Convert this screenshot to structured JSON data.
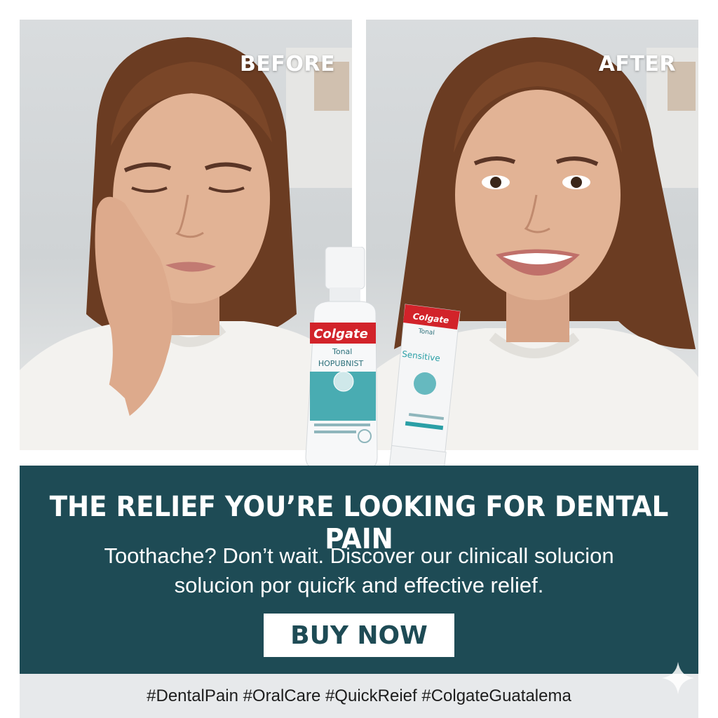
{
  "photos": {
    "before_label": "BEFORE",
    "after_label": "AFTER"
  },
  "products": {
    "mouthwash_brand": "Colgate",
    "mouthwash_line": "Tonal",
    "mouthwash_name": "HOPUBNIST",
    "toothpaste_brand": "Colgate",
    "toothpaste_line": "Tonal",
    "toothpaste_name": "Sensitive"
  },
  "banner": {
    "headline": "THE RELIEF YOU’RE LOOKING FOR DENTAL PAIN",
    "subtext_line1": "Toothache? Don’t wait. Discover our clinicall solucion",
    "subtext_line2": "solucion por quicřk and effective relief.",
    "button_label": "BUY NOW"
  },
  "footer": {
    "hashtags": "#DentalPain #OralCare #QuickReief #ColgateGuatalema"
  },
  "colors": {
    "banner_bg": "#1e4b55",
    "footer_bg": "#e7e9eb",
    "brand_red": "#d2232a",
    "accent_teal": "#2a9fa6"
  }
}
